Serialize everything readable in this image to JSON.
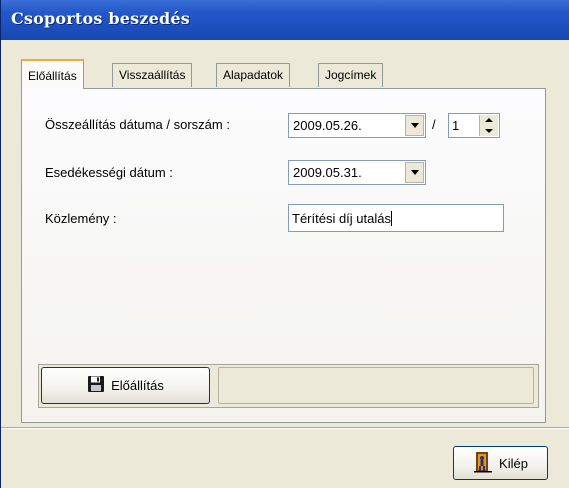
{
  "window": {
    "title": "Csoportos beszedés"
  },
  "tabs": [
    {
      "label": "Előállítás",
      "active": true
    },
    {
      "label": "Visszaállítás",
      "active": false
    },
    {
      "label": "Alapadatok",
      "active": false
    },
    {
      "label": "Jogcímek",
      "active": false
    }
  ],
  "form": {
    "compile_date_label": "Összeállítás dátuma / sorszám :",
    "compile_date_value": "2009.05.26.",
    "separator": "/",
    "sequence_value": "1",
    "due_date_label": "Esedékességi dátum :",
    "due_date_value": "2009.05.31.",
    "notice_label": "Közlemény :",
    "notice_value": "Térítési díj utalás"
  },
  "actions": {
    "generate_label": "Előállítás",
    "exit_label": "Kilép"
  },
  "icons": {
    "generate": "floppy-disk-icon",
    "exit": "door-exit-icon"
  },
  "colors": {
    "titlebar": "#1c4fbe",
    "active_tab_highlight": "#f3a93c",
    "window_face": "#ece9d8"
  }
}
